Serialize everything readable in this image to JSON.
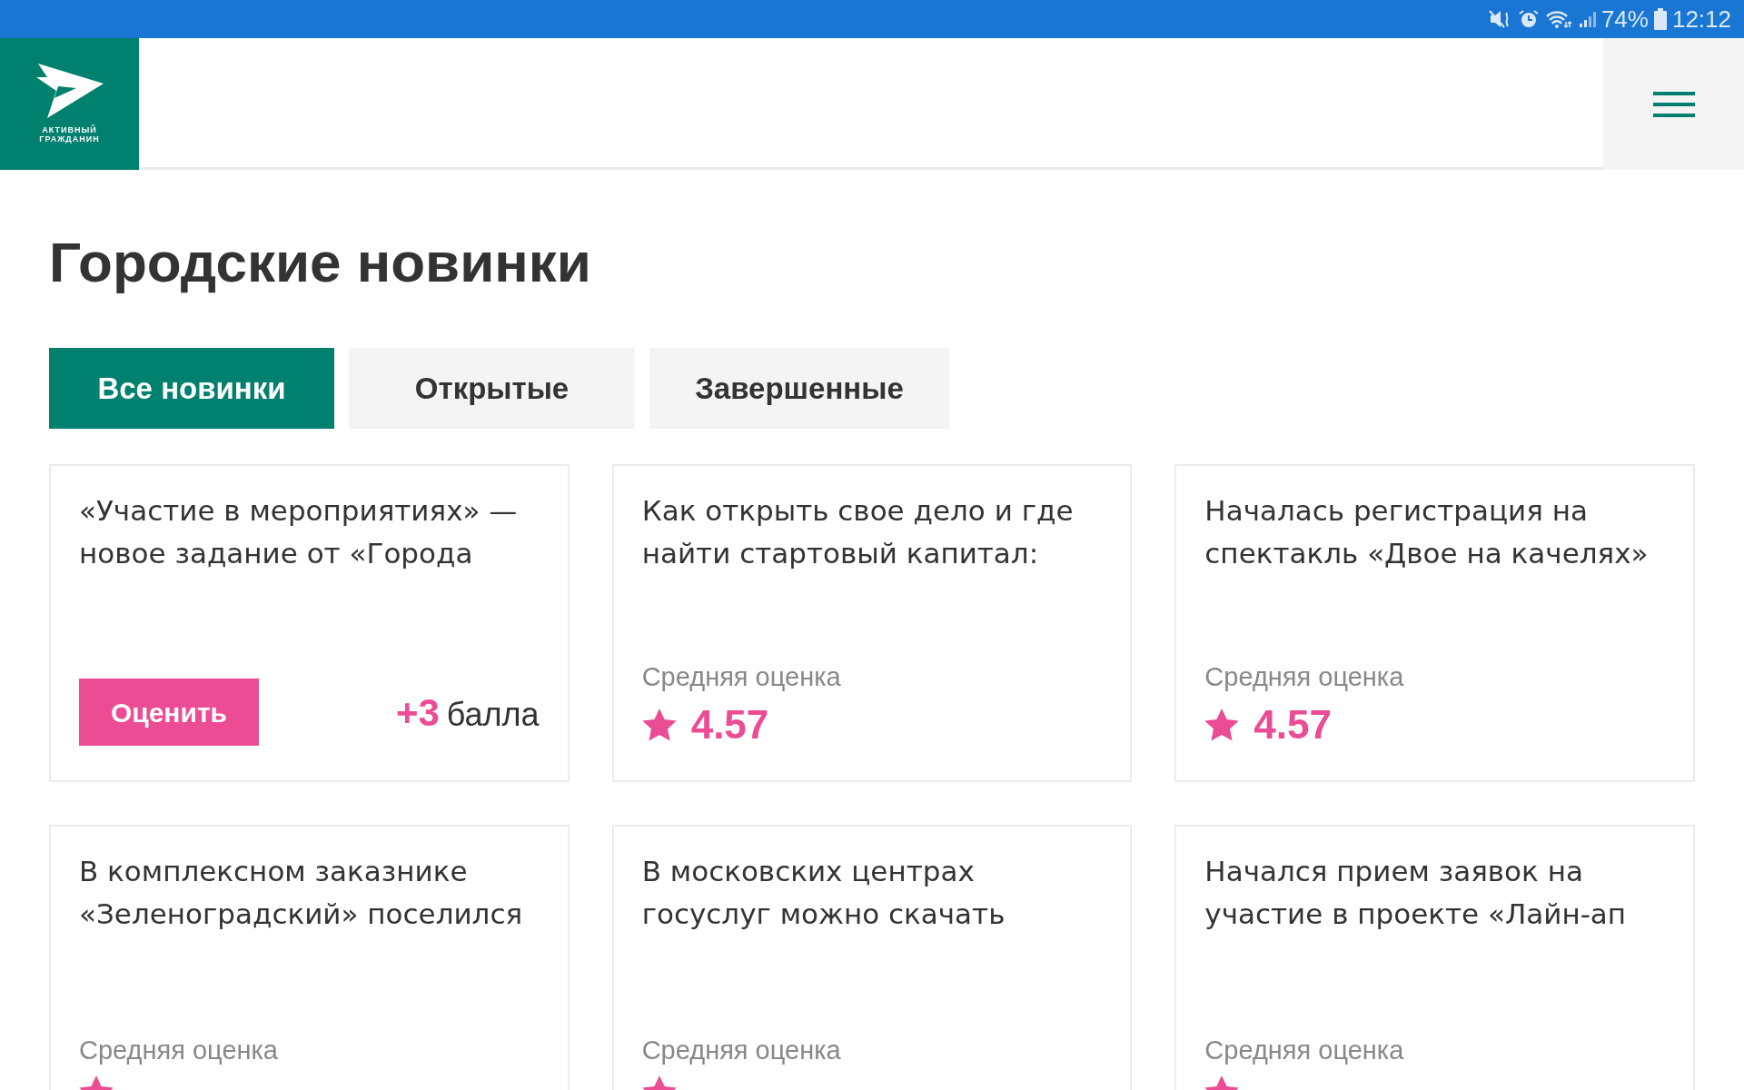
{
  "status_bar": {
    "battery": "74%",
    "time": "12:12"
  },
  "logo": {
    "line_1": "АКТИВНЫЙ",
    "line_2": "ГРАЖДАНИН"
  },
  "title": "Городские новинки",
  "tabs": [
    {
      "label": "Все новинки",
      "selected": true
    },
    {
      "label": "Открытые",
      "selected": false
    },
    {
      "label": "Завершенные",
      "selected": false
    }
  ],
  "cards": [
    {
      "kind": "action",
      "title": "«Участие в мероприятиях» — новое задание от «Города",
      "button": "Оценить",
      "points": "+3",
      "points_unit": "балла"
    },
    {
      "kind": "rating",
      "title": "Как открыть свое дело и где найти стартовый капитал:",
      "rating_label": "Средняя оценка",
      "rating": "4.57"
    },
    {
      "kind": "rating",
      "title": "Началась регистрация на спектакль «Двое на качелях»",
      "rating_label": "Средняя оценка",
      "rating": "4.57"
    },
    {
      "kind": "rating",
      "title": "В комплексном заказнике «Зеленоградский» поселился",
      "rating_label": "Средняя оценка"
    },
    {
      "kind": "rating",
      "title": "В московских центрах госуслуг можно скачать",
      "rating_label": "Средняя оценка"
    },
    {
      "kind": "rating",
      "title": "Начался прием заявок на участие в проекте «Лайн-ап",
      "rating_label": "Средняя оценка"
    }
  ]
}
